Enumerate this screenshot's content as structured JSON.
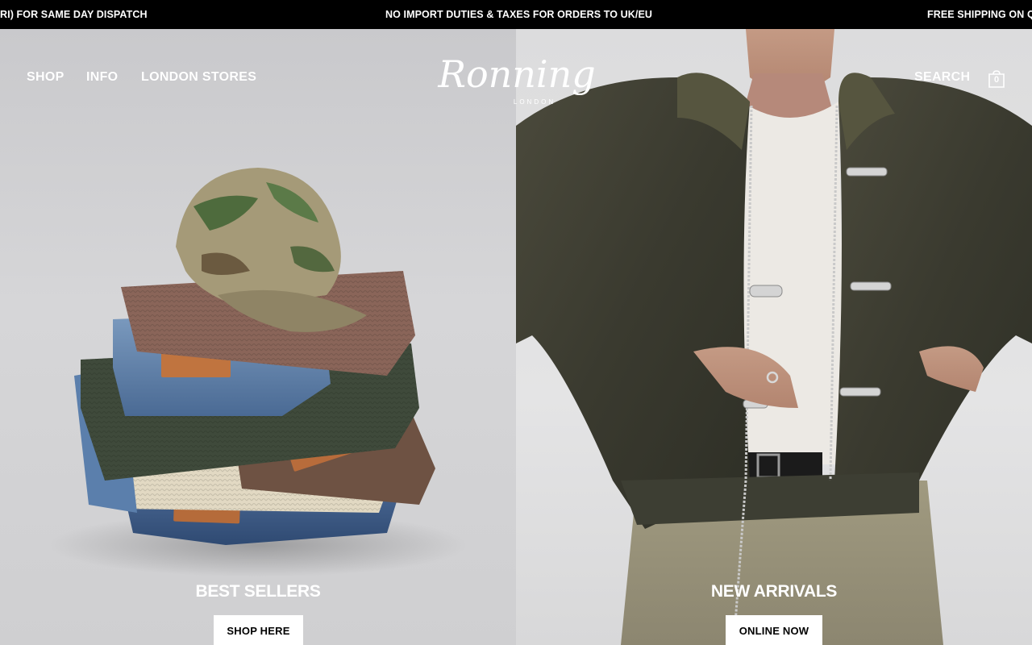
{
  "announcement": {
    "left": "RI) FOR SAME DAY DISPATCH",
    "center": "NO IMPORT DUTIES & TAXES FOR ORDERS TO UK/EU",
    "right": "FREE SHIPPING ON QU"
  },
  "nav": {
    "shop": "SHOP",
    "info": "INFO",
    "stores": "LONDON STORES",
    "search": "SEARCH",
    "cart_count": "0"
  },
  "logo": {
    "script": "Ronning",
    "sub": "LONDON"
  },
  "panels": {
    "left": {
      "title": "BEST SELLERS",
      "button": "SHOP HERE",
      "image": "folded-clothes-stack-with-camo-cap"
    },
    "right": {
      "title": "NEW ARRIVALS",
      "button": "ONLINE NOW",
      "image": "model-in-olive-fur-bomber-jacket"
    }
  },
  "colors": {
    "bar": "#000000",
    "text": "#ffffff",
    "button_bg": "#ffffff"
  }
}
